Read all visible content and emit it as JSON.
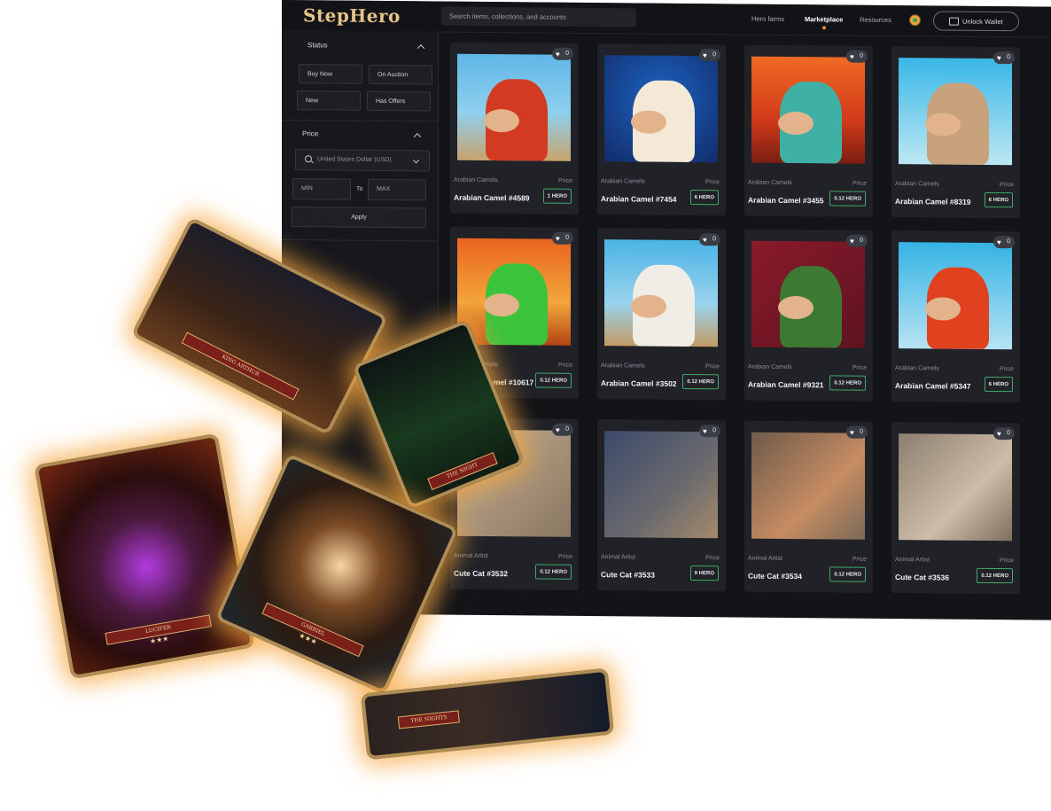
{
  "app": {
    "logo": "StepHero",
    "search_placeholder": "Search items, collections, and accounts",
    "nav": [
      "Hero farms",
      "Marketplace",
      "Resources"
    ],
    "wallet_button": "Unlock Wallet"
  },
  "sidebar": {
    "status_title": "Status",
    "status_filters": [
      "Buy Now",
      "On Auction",
      "New",
      "Has Offers"
    ],
    "price_title": "Price",
    "currency": "United States Dollar (USD)",
    "min_placeholder": "MIN",
    "to_label": "To",
    "max_placeholder": "MAX",
    "apply_button": "Apply"
  },
  "cards": [
    {
      "collection": "Arabian Camels",
      "price_label": "Price",
      "name": "Arabian Camel #4589",
      "price": "1 HERO",
      "likes": "0"
    },
    {
      "collection": "Arabian Camels",
      "price_label": "Price",
      "name": "Arabian Camel #7454",
      "price": "6 HERO",
      "likes": "0"
    },
    {
      "collection": "Arabian Camels",
      "price_label": "Price",
      "name": "Arabian Camel #3455",
      "price": "0.12 HERO",
      "likes": "0"
    },
    {
      "collection": "Arabian Camels",
      "price_label": "Price",
      "name": "Arabian Camel #8319",
      "price": "6 HERO",
      "likes": "0"
    },
    {
      "collection": "Arabian Camels",
      "price_label": "Price",
      "name": "Arabian Camel #10617",
      "price": "0.12 HERO",
      "likes": "0"
    },
    {
      "collection": "Arabian Camels",
      "price_label": "Price",
      "name": "Arabian Camel #3502",
      "price": "0.12 HERO",
      "likes": "0"
    },
    {
      "collection": "Arabian Camels",
      "price_label": "Price",
      "name": "Arabian Camel #9321",
      "price": "0.12 HERO",
      "likes": "0"
    },
    {
      "collection": "Arabian Camels",
      "price_label": "Price",
      "name": "Arabian Camel #5347",
      "price": "6 HERO",
      "likes": "0"
    },
    {
      "collection": "Animal Artist",
      "price_label": "Price",
      "name": "Cute Cat #3532",
      "price": "0.12 HERO",
      "likes": "0"
    },
    {
      "collection": "Animal Artist",
      "price_label": "Price",
      "name": "Cute Cat #3533",
      "price": "9 HERO",
      "likes": "0"
    },
    {
      "collection": "Animal Artist",
      "price_label": "Price",
      "name": "Cute Cat #3534",
      "price": "0.12 HERO",
      "likes": "0"
    },
    {
      "collection": "Animal Artist",
      "price_label": "Price",
      "name": "Cute Cat #3536",
      "price": "0.12 HERO",
      "likes": "0"
    }
  ],
  "hero_cards": [
    "KING ARTHUR",
    "THE NIGHT",
    "LUCIFER",
    "GABRIEL",
    "THE NIGHTS"
  ],
  "colors": {
    "accent": "#e58a3c",
    "price_border": "#3fa967",
    "glow": "#f6a63e"
  },
  "icons": [
    "search-icon",
    "wallet-icon",
    "heart-icon",
    "chevron-up-icon",
    "chevron-down-icon",
    "coin-icon"
  ]
}
